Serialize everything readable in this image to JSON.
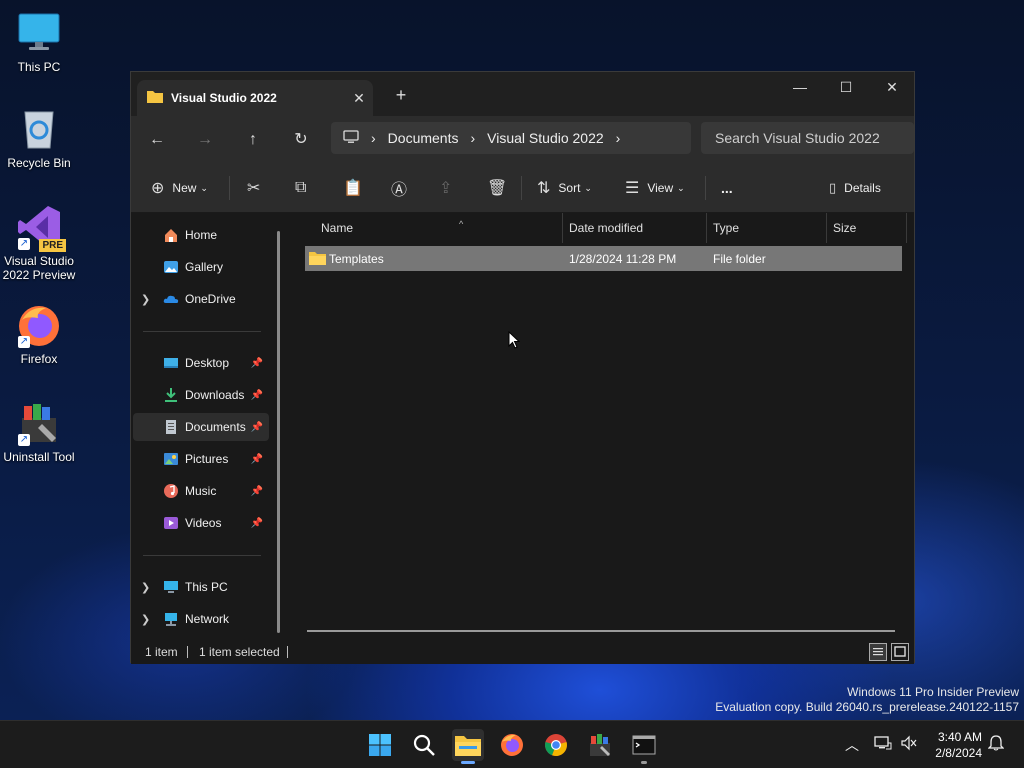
{
  "desktop": {
    "icons": [
      {
        "label": "This PC"
      },
      {
        "label": "Recycle Bin"
      },
      {
        "label": "Visual Studio 2022 Preview",
        "badge": "PRE"
      },
      {
        "label": "Firefox"
      },
      {
        "label": "Uninstall Tool"
      }
    ]
  },
  "window": {
    "tab_title": "Visual Studio 2022",
    "address": {
      "segments": [
        "Documents",
        "Visual Studio 2022"
      ]
    },
    "search_placeholder": "Search Visual Studio 2022",
    "commands": {
      "new": "New",
      "sort": "Sort",
      "view": "View",
      "more": "...",
      "details": "Details"
    },
    "nav": {
      "top": [
        {
          "label": "Home"
        },
        {
          "label": "Gallery"
        },
        {
          "label": "OneDrive"
        }
      ],
      "quick": [
        {
          "label": "Desktop"
        },
        {
          "label": "Downloads"
        },
        {
          "label": "Documents"
        },
        {
          "label": "Pictures"
        },
        {
          "label": "Music"
        },
        {
          "label": "Videos"
        }
      ],
      "bottom": [
        {
          "label": "This PC"
        },
        {
          "label": "Network"
        }
      ]
    },
    "columns": {
      "name": "Name",
      "date": "Date modified",
      "type": "Type",
      "size": "Size"
    },
    "files": [
      {
        "name": "Templates",
        "date": "1/28/2024 11:28 PM",
        "type": "File folder",
        "size": ""
      }
    ],
    "status": {
      "count": "1 item",
      "selected": "1 item selected"
    }
  },
  "watermark": {
    "line1": "Windows 11 Pro Insider Preview",
    "line2": "Evaluation copy. Build 26040.rs_prerelease.240122-1157"
  },
  "clock": {
    "time": "3:40 AM",
    "date": "2/8/2024"
  },
  "colors": {
    "accent": "#6aa8ff",
    "folder": "#f5c542",
    "selection": "#777777"
  }
}
